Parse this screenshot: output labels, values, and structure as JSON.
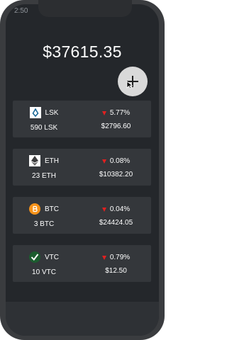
{
  "status": {
    "time": "2:50"
  },
  "portfolio": {
    "total": "$37615.35"
  },
  "add_button": {
    "icon": "plus-icon"
  },
  "coins": [
    {
      "symbol": "LSK",
      "amount": "590 LSK",
      "change": "5.77%",
      "price": "$2796.60",
      "icon": "lisk-icon",
      "icon_bg": "#ffffff",
      "icon_fg": "#1a6896"
    },
    {
      "symbol": "ETH",
      "amount": "23 ETH",
      "change": "0.08%",
      "price": "$10382.20",
      "icon": "ethereum-icon",
      "icon_bg": "#ffffff",
      "icon_fg": "#3c3c3d"
    },
    {
      "symbol": "BTC",
      "amount": "3 BTC",
      "change": "0.04%",
      "price": "$24424.05",
      "icon": "bitcoin-icon",
      "icon_bg": "#f7931a",
      "icon_fg": "#ffffff"
    },
    {
      "symbol": "VTC",
      "amount": "10 VTC",
      "change": "0.79%",
      "price": "$12.50",
      "icon": "vertcoin-icon",
      "icon_bg": "#1b5c2e",
      "icon_fg": "#ffffff"
    }
  ],
  "colors": {
    "background": "#24272b",
    "card": "#34373b",
    "down": "#e02020",
    "add_button": "#d9d9d9"
  }
}
